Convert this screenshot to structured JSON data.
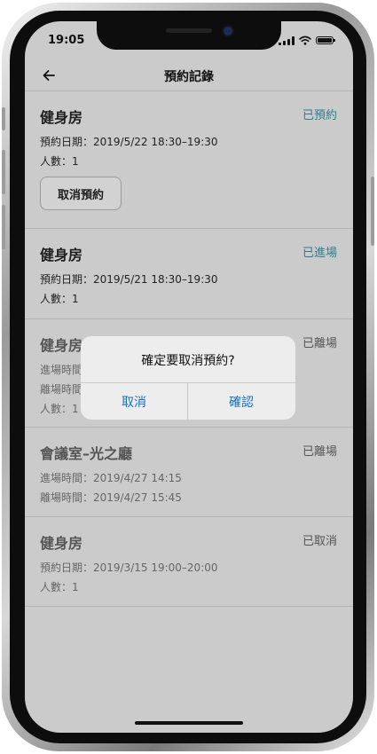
{
  "status_bar": {
    "time": "19:05"
  },
  "nav": {
    "title": "預約記錄"
  },
  "colors": {
    "accent": "#2e7d8c",
    "dialog_button": "#1a6fc0",
    "status_inactive": "#555555"
  },
  "records": [
    {
      "title": "健身房",
      "status": "已預約",
      "lines": [
        "預約日期：2019/5/22 18:30–19:30",
        "人數：1"
      ],
      "action_label": "取消預約"
    },
    {
      "title": "健身房",
      "status": "已進場",
      "lines": [
        "預約日期：2019/5/21 18:30–19:30",
        "人數：1"
      ]
    },
    {
      "title": "健身房",
      "status": "已離場",
      "lines": [
        "進場時間",
        "離場時間",
        "人數：1"
      ]
    },
    {
      "title": "會議室–光之廳",
      "status": "已離場",
      "lines": [
        "進場時間：2019/4/27 14:15",
        "離場時間：2019/4/27 15:45"
      ]
    },
    {
      "title": "健身房",
      "status": "已取消",
      "lines": [
        "預約日期：2019/3/15 19:00–20:00",
        "人數：1"
      ]
    }
  ],
  "dialog": {
    "message": "確定要取消預約?",
    "cancel_label": "取消",
    "confirm_label": "確認"
  },
  "icons": {
    "back": "arrow-left-icon",
    "signal": "signal-icon",
    "wifi": "wifi-icon",
    "battery": "battery-icon"
  }
}
